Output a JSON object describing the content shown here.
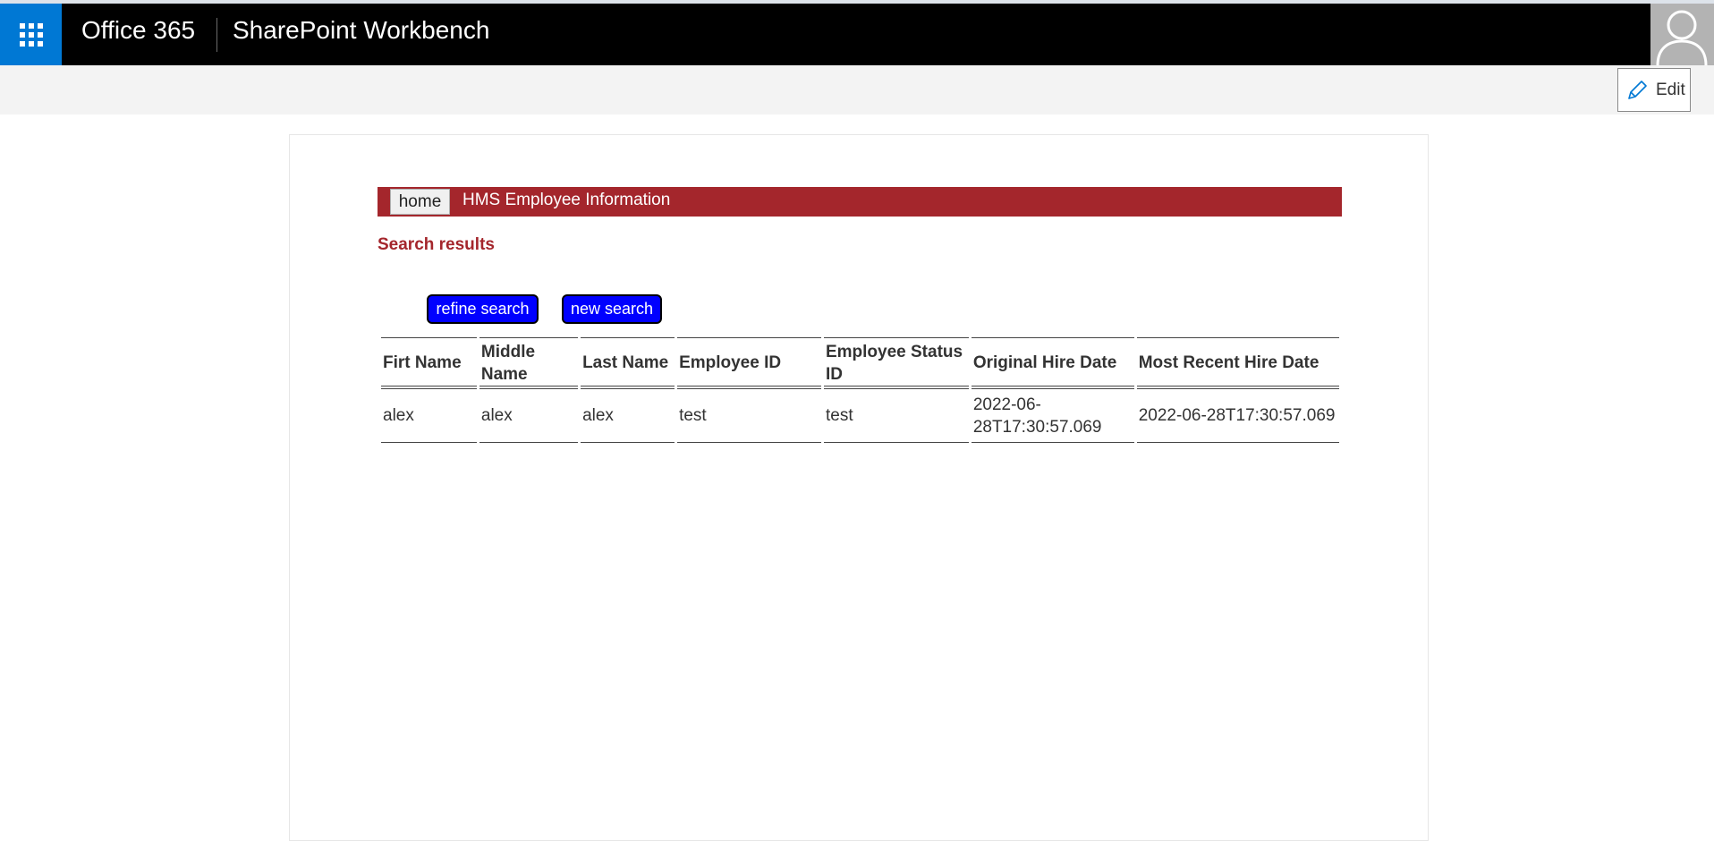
{
  "header": {
    "brand": "Office 365",
    "product": "SharePoint Workbench",
    "colors": {
      "bar": "#000000",
      "waffle": "#0078d4"
    },
    "icons": {
      "waffle": "app-launcher-icon",
      "avatar": "user-avatar-icon"
    }
  },
  "command_bar": {
    "edit_label": "Edit",
    "edit_icon": "pencil-icon"
  },
  "webpart": {
    "home_label": "home",
    "title": "HMS Employee Information",
    "subtitle": "Search results",
    "accent_color": "#a4262c",
    "buttons": {
      "refine": "refine search",
      "new": "new search"
    },
    "table": {
      "headers": [
        "Firt Name",
        "Middle Name",
        "Last Name",
        "Employee ID",
        "Employee Status ID",
        "Original Hire Date",
        "Most Recent Hire Date"
      ],
      "rows": [
        [
          "alex",
          "alex",
          "alex",
          "test",
          "test",
          "2022-06-28T17:30:57.069",
          "2022-06-28T17:30:57.069"
        ]
      ]
    }
  }
}
